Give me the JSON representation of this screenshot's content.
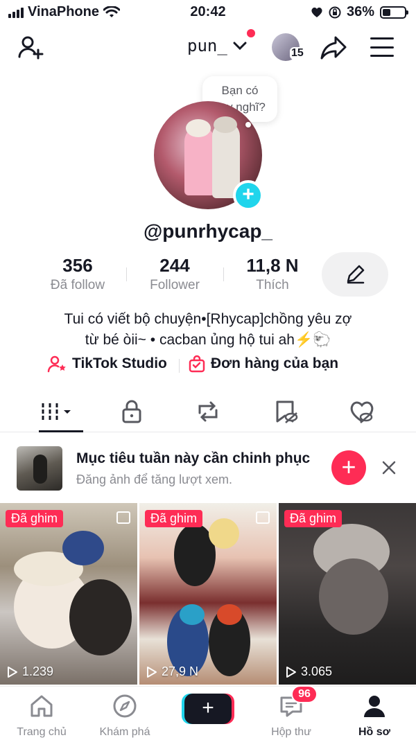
{
  "status_bar": {
    "carrier": "VinaPhone",
    "time": "20:42",
    "battery_percent": "36%",
    "battery_level": 0.36
  },
  "top_nav": {
    "username": "pun_",
    "story_count": "15"
  },
  "profile": {
    "bubble_text_line1": "Bạn có",
    "bubble_text_line2": "suy nghĩ?",
    "handle": "@punrhycap_"
  },
  "stats": [
    {
      "value": "356",
      "label": "Đã follow"
    },
    {
      "value": "244",
      "label": "Follower"
    },
    {
      "value": "11,8 N",
      "label": "Thích"
    }
  ],
  "bio": {
    "line1": "Tui có viết bộ chuyện•[Rhycap]chồng yêu zợ",
    "line2": "từ bé òii~ • cacban ủng hộ tui ah⚡️🐑"
  },
  "links": {
    "studio": "TikTok Studio",
    "orders": "Đơn hàng của bạn"
  },
  "goal": {
    "title": "Mục tiêu tuần này cần chinh phục",
    "subtitle": "Đăng ảnh để tăng lượt xem."
  },
  "videos": [
    {
      "pin": "Đã ghim",
      "views": "1.239"
    },
    {
      "pin": "Đã ghim",
      "views": "27,9 N"
    },
    {
      "pin": "Đã ghim",
      "views": "3.065"
    }
  ],
  "bottom_nav": {
    "home": "Trang chủ",
    "explore": "Khám phá",
    "inbox": "Hộp thư",
    "inbox_badge": "96",
    "profile": "Hồ sơ"
  },
  "colors": {
    "accent": "#fe2c55",
    "cyan": "#20d5ec",
    "text": "#161823",
    "muted": "#8a8b91"
  }
}
